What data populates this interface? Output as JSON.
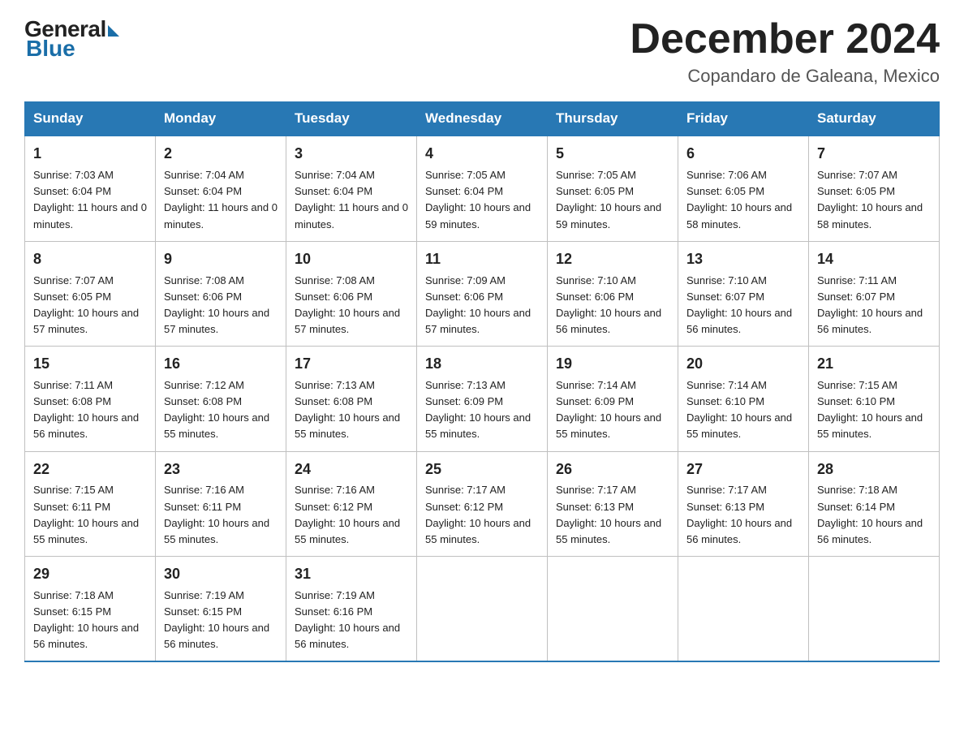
{
  "logo": {
    "general": "General",
    "blue": "Blue"
  },
  "title": "December 2024",
  "location": "Copandaro de Galeana, Mexico",
  "days_of_week": [
    "Sunday",
    "Monday",
    "Tuesday",
    "Wednesday",
    "Thursday",
    "Friday",
    "Saturday"
  ],
  "weeks": [
    [
      {
        "day": "1",
        "sunrise": "7:03 AM",
        "sunset": "6:04 PM",
        "daylight": "11 hours and 0 minutes."
      },
      {
        "day": "2",
        "sunrise": "7:04 AM",
        "sunset": "6:04 PM",
        "daylight": "11 hours and 0 minutes."
      },
      {
        "day": "3",
        "sunrise": "7:04 AM",
        "sunset": "6:04 PM",
        "daylight": "11 hours and 0 minutes."
      },
      {
        "day": "4",
        "sunrise": "7:05 AM",
        "sunset": "6:04 PM",
        "daylight": "10 hours and 59 minutes."
      },
      {
        "day": "5",
        "sunrise": "7:05 AM",
        "sunset": "6:05 PM",
        "daylight": "10 hours and 59 minutes."
      },
      {
        "day": "6",
        "sunrise": "7:06 AM",
        "sunset": "6:05 PM",
        "daylight": "10 hours and 58 minutes."
      },
      {
        "day": "7",
        "sunrise": "7:07 AM",
        "sunset": "6:05 PM",
        "daylight": "10 hours and 58 minutes."
      }
    ],
    [
      {
        "day": "8",
        "sunrise": "7:07 AM",
        "sunset": "6:05 PM",
        "daylight": "10 hours and 57 minutes."
      },
      {
        "day": "9",
        "sunrise": "7:08 AM",
        "sunset": "6:06 PM",
        "daylight": "10 hours and 57 minutes."
      },
      {
        "day": "10",
        "sunrise": "7:08 AM",
        "sunset": "6:06 PM",
        "daylight": "10 hours and 57 minutes."
      },
      {
        "day": "11",
        "sunrise": "7:09 AM",
        "sunset": "6:06 PM",
        "daylight": "10 hours and 57 minutes."
      },
      {
        "day": "12",
        "sunrise": "7:10 AM",
        "sunset": "6:06 PM",
        "daylight": "10 hours and 56 minutes."
      },
      {
        "day": "13",
        "sunrise": "7:10 AM",
        "sunset": "6:07 PM",
        "daylight": "10 hours and 56 minutes."
      },
      {
        "day": "14",
        "sunrise": "7:11 AM",
        "sunset": "6:07 PM",
        "daylight": "10 hours and 56 minutes."
      }
    ],
    [
      {
        "day": "15",
        "sunrise": "7:11 AM",
        "sunset": "6:08 PM",
        "daylight": "10 hours and 56 minutes."
      },
      {
        "day": "16",
        "sunrise": "7:12 AM",
        "sunset": "6:08 PM",
        "daylight": "10 hours and 55 minutes."
      },
      {
        "day": "17",
        "sunrise": "7:13 AM",
        "sunset": "6:08 PM",
        "daylight": "10 hours and 55 minutes."
      },
      {
        "day": "18",
        "sunrise": "7:13 AM",
        "sunset": "6:09 PM",
        "daylight": "10 hours and 55 minutes."
      },
      {
        "day": "19",
        "sunrise": "7:14 AM",
        "sunset": "6:09 PM",
        "daylight": "10 hours and 55 minutes."
      },
      {
        "day": "20",
        "sunrise": "7:14 AM",
        "sunset": "6:10 PM",
        "daylight": "10 hours and 55 minutes."
      },
      {
        "day": "21",
        "sunrise": "7:15 AM",
        "sunset": "6:10 PM",
        "daylight": "10 hours and 55 minutes."
      }
    ],
    [
      {
        "day": "22",
        "sunrise": "7:15 AM",
        "sunset": "6:11 PM",
        "daylight": "10 hours and 55 minutes."
      },
      {
        "day": "23",
        "sunrise": "7:16 AM",
        "sunset": "6:11 PM",
        "daylight": "10 hours and 55 minutes."
      },
      {
        "day": "24",
        "sunrise": "7:16 AM",
        "sunset": "6:12 PM",
        "daylight": "10 hours and 55 minutes."
      },
      {
        "day": "25",
        "sunrise": "7:17 AM",
        "sunset": "6:12 PM",
        "daylight": "10 hours and 55 minutes."
      },
      {
        "day": "26",
        "sunrise": "7:17 AM",
        "sunset": "6:13 PM",
        "daylight": "10 hours and 55 minutes."
      },
      {
        "day": "27",
        "sunrise": "7:17 AM",
        "sunset": "6:13 PM",
        "daylight": "10 hours and 56 minutes."
      },
      {
        "day": "28",
        "sunrise": "7:18 AM",
        "sunset": "6:14 PM",
        "daylight": "10 hours and 56 minutes."
      }
    ],
    [
      {
        "day": "29",
        "sunrise": "7:18 AM",
        "sunset": "6:15 PM",
        "daylight": "10 hours and 56 minutes."
      },
      {
        "day": "30",
        "sunrise": "7:19 AM",
        "sunset": "6:15 PM",
        "daylight": "10 hours and 56 minutes."
      },
      {
        "day": "31",
        "sunrise": "7:19 AM",
        "sunset": "6:16 PM",
        "daylight": "10 hours and 56 minutes."
      },
      null,
      null,
      null,
      null
    ]
  ]
}
